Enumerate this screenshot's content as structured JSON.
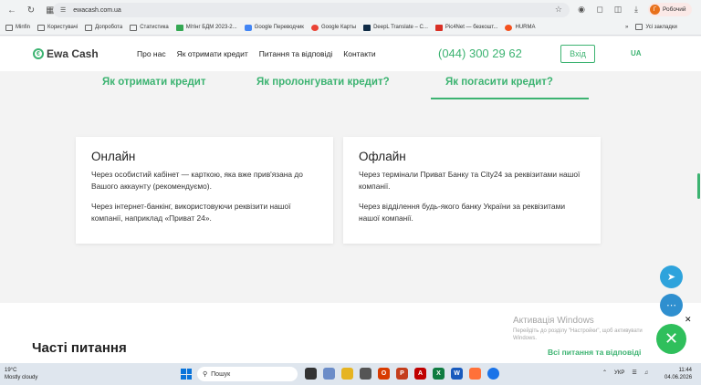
{
  "browser": {
    "url": "ewacash.com.ua",
    "profile_label": "Робочий",
    "profile_initial": "Г",
    "bookmarks": [
      "Minfin",
      "Користувачі",
      "Допробота",
      "Статистика",
      "Мітінг БДМ 2023-2...",
      "Google Переводчик",
      "Google Карты",
      "DeepL Translate – C...",
      "Pic4Net — безкошт...",
      "HURMA"
    ],
    "bookmarks_overflow": "»",
    "bookmarks_all": "Усі закладки"
  },
  "header": {
    "logo": "Ewa Cash",
    "nav": [
      "Про нас",
      "Як отримати кредит",
      "Питання та відповіді",
      "Контакти"
    ],
    "phone": "(044) 300 29 62",
    "login": "Вхід",
    "lang": "UA"
  },
  "tabs": {
    "items": [
      "Як отримати кредит",
      "Як пролонгувати кредит?",
      "Як погасити кредит?"
    ],
    "active_index": 2
  },
  "cards": [
    {
      "title": "Онлайн",
      "paragraphs": [
        "Через особистий кабінет — карткою, яка вже прив'язана до Вашого аккаунту (рекомендуємо).",
        "Через інтернет-банкінг, використовуючи реквізити нашої компанії, наприклад «Приват 24»."
      ]
    },
    {
      "title": "Офлайн",
      "paragraphs": [
        "Через термінали Приват Банку та City24 за реквізитами нашої компанії.",
        "Через відділення будь-якого банку України за реквізитами нашої компанії."
      ]
    }
  ],
  "faq": {
    "title": "Часті питання",
    "all_link": "Всі питання та відповіді"
  },
  "windows_activation": {
    "title": "Активація Windows",
    "text": "Перейдіть до розділу \"Настройки\", щоб активувати Windows."
  },
  "taskbar": {
    "weather_temp": "19°C",
    "weather_desc": "Mostly cloudy",
    "search_placeholder": "Пошук",
    "lang": "УКР",
    "time": "11:44",
    "date": "04.06.2026"
  },
  "colors": {
    "brand_green": "#3cb371",
    "telegram_blue": "#2ea3dc",
    "fab_green": "#2fbf5c"
  }
}
